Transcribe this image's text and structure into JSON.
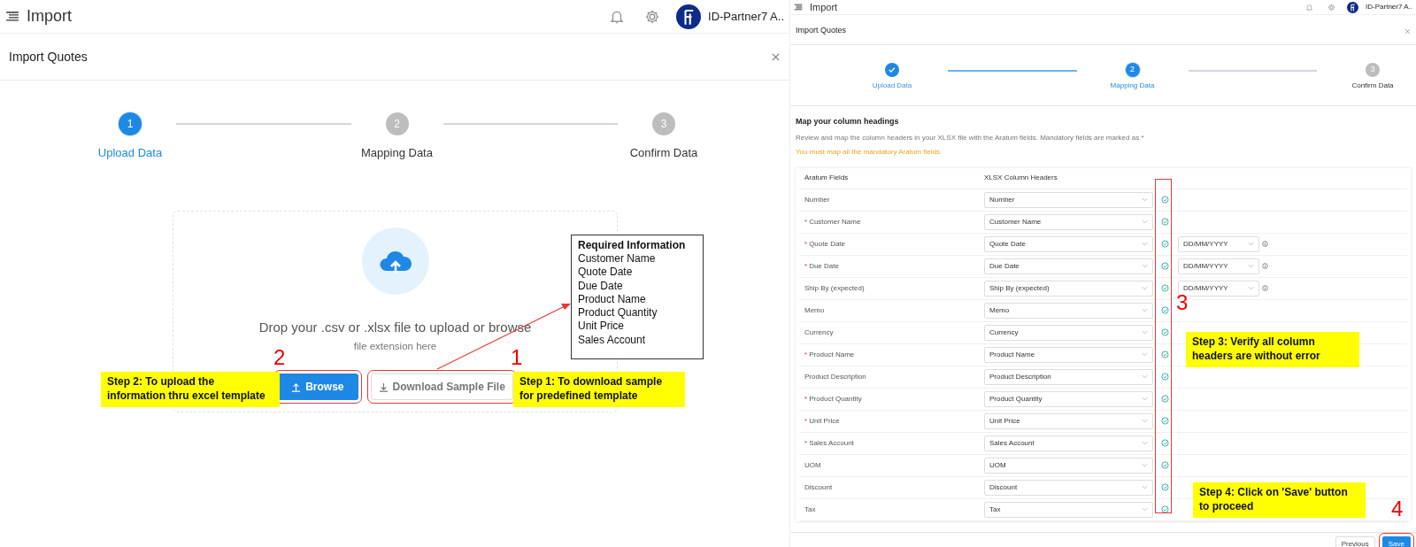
{
  "left_screen": {
    "header": {
      "title": "Import",
      "user": "ID-Partner7 A.."
    },
    "modal_title": "Import Quotes",
    "steps": [
      {
        "number": "1",
        "label": "Upload Data",
        "done": false,
        "selected": true
      },
      {
        "number": "2",
        "label": "Mapping Data",
        "done": false,
        "selected": false
      },
      {
        "number": "3",
        "label": "Confirm Data",
        "done": false,
        "selected": false
      }
    ],
    "upload": {
      "message": "Drop your .csv or .xlsx file to upload or browse",
      "hint": "file extension here",
      "browse_button": "Browse",
      "download_button": "Download Sample File"
    }
  },
  "right_screen": {
    "header": {
      "title": "Import",
      "user": "ID-Partner7 A.."
    },
    "modal_title": "Import Quotes",
    "steps": [
      {
        "label": "Upload Data",
        "done": true,
        "selected": false
      },
      {
        "number": "2",
        "label": "Mapping Data",
        "done": false,
        "selected": true
      },
      {
        "number": "3",
        "label": "Confirm Data",
        "done": false,
        "selected": false
      }
    ],
    "mapping": {
      "heading": "Map your column headings",
      "description": "Review and map the column headers in your XLSX file with the Aratum fields. Mandatory fields are marked as *",
      "warning": "You must map all the mandatory Aratum fields.",
      "required_mark": "*",
      "columns": [
        "Aratum Fields",
        "XLSX Column Headers"
      ],
      "rows": [
        {
          "field": "Number",
          "required": false,
          "value": "Number",
          "valid": true
        },
        {
          "field": "Customer Name",
          "required": true,
          "value": "Customer Name",
          "valid": true
        },
        {
          "field": "Quote Date",
          "required": true,
          "value": "Quote Date",
          "valid": true,
          "date_format": "DD/MM/YYYY"
        },
        {
          "field": "Due Date",
          "required": true,
          "value": "Due Date",
          "valid": true,
          "date_format": "DD/MM/YYYY"
        },
        {
          "field": "Ship By (expected)",
          "required": false,
          "value": "Ship By (expected)",
          "valid": true,
          "date_format": "DD/MM/YYYY"
        },
        {
          "field": "Memo",
          "required": false,
          "value": "Memo",
          "valid": true
        },
        {
          "field": "Currency",
          "required": false,
          "value": "Currency",
          "valid": true
        },
        {
          "field": "Product Name",
          "required": true,
          "value": "Product Name",
          "valid": true
        },
        {
          "field": "Product Description",
          "required": false,
          "value": "Product Description",
          "valid": true
        },
        {
          "field": "Product Quantity",
          "required": true,
          "value": "Product Quantity",
          "valid": true
        },
        {
          "field": "Unit Price",
          "required": true,
          "value": "Unit Price",
          "valid": true
        },
        {
          "field": "Sales Account",
          "required": true,
          "value": "Sales Account",
          "valid": true
        },
        {
          "field": "UOM",
          "required": false,
          "value": "UOM",
          "valid": true
        },
        {
          "field": "Discount",
          "required": false,
          "value": "Discount",
          "valid": true
        },
        {
          "field": "Tax",
          "required": false,
          "value": "Tax",
          "valid": true
        }
      ]
    },
    "buttons": {
      "previous": "Previous",
      "save": "Save"
    }
  },
  "annotations": [
    {
      "kind": "infobox",
      "title": "Required Information",
      "lines": [
        "Customer Name",
        "Quote Date",
        "Due Date",
        "Product Name",
        "Product Quantity",
        "Unit Price",
        "Sales Account"
      ]
    },
    {
      "kind": "number",
      "text": "2"
    },
    {
      "kind": "number",
      "text": "1"
    },
    {
      "kind": "callout",
      "text": "Step 2: To upload the information thru excel template"
    },
    {
      "kind": "callout",
      "text": "Step 1: To download sample for predefined template"
    },
    {
      "kind": "number",
      "text": "3"
    },
    {
      "kind": "callout",
      "text": "Step 3: Verify all column headers are without error"
    },
    {
      "kind": "callout",
      "text": "Step 4: Click on 'Save' button to proceed"
    },
    {
      "kind": "number",
      "text": "4"
    }
  ]
}
